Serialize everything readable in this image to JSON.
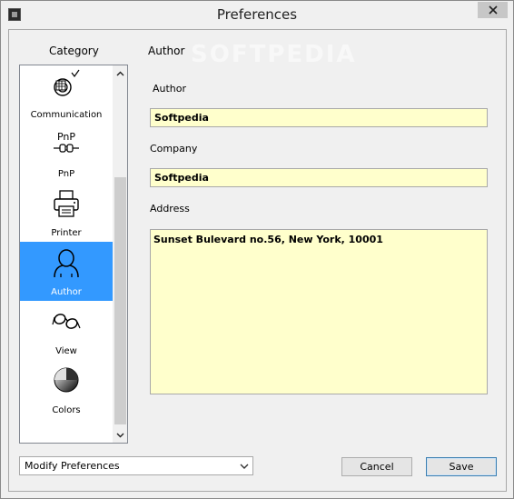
{
  "window": {
    "title": "Preferences",
    "close_icon": "close-icon"
  },
  "sidebar": {
    "heading": "Category",
    "items": [
      {
        "label": "Communication",
        "icon": "communication-icon",
        "selected": false
      },
      {
        "label": "PnP",
        "icon": "pnp-icon",
        "icon_text": "PnP",
        "selected": false
      },
      {
        "label": "Printer",
        "icon": "printer-icon",
        "selected": false
      },
      {
        "label": "Author",
        "icon": "author-icon",
        "selected": true
      },
      {
        "label": "View",
        "icon": "glasses-icon",
        "selected": false
      },
      {
        "label": "Colors",
        "icon": "colors-icon",
        "selected": false
      }
    ]
  },
  "panel": {
    "heading": "Author",
    "watermark": "SOFTPEDIA",
    "fields": {
      "author_label": "Author",
      "author_value": "Softpedia",
      "company_label": "Company",
      "company_value": "Softpedia",
      "address_label": "Address",
      "address_value": "Sunset Bulevard no.56, New York, 10001"
    }
  },
  "footer": {
    "dropdown_value": "Modify Preferences",
    "cancel_label": "Cancel",
    "save_label": "Save"
  },
  "colors": {
    "selected_bg": "#3399ff",
    "field_bg": "#ffffcc"
  }
}
